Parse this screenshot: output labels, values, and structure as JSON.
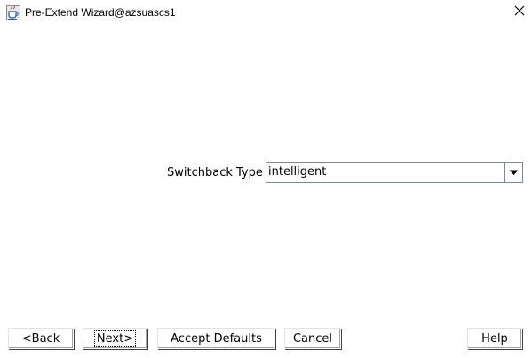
{
  "window": {
    "title": "Pre-Extend Wizard@azsuascs1",
    "app_icon": "java-cup-icon",
    "close_icon": "close-icon"
  },
  "form": {
    "switchback_label": "Switchback Type",
    "switchback_value": "intelligent",
    "dropdown_icon": "chevron-down-icon"
  },
  "buttons": {
    "back": "<Back",
    "next": "Next>",
    "accept_defaults": "Accept Defaults",
    "cancel": "Cancel",
    "help": "Help"
  }
}
